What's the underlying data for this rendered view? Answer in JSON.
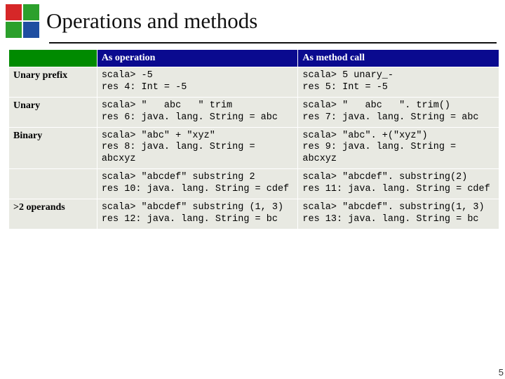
{
  "title": "Operations and methods",
  "logo_colors": {
    "tl": "#d62728",
    "tr": "#2ca02c",
    "bl": "#2ca02c",
    "br": "#1f4ea1"
  },
  "header": {
    "corner": "",
    "col1": "As operation",
    "col2": "As method call"
  },
  "rows": [
    {
      "label": "Unary prefix",
      "op": "scala> -5\nres 4: Int = -5",
      "mc": "scala> 5 unary_-\nres 5: Int = -5"
    },
    {
      "label": "Unary",
      "op": "scala> \"   abc   \" trim\nres 6: java. lang. String = abc",
      "mc": "scala> \"   abc   \". trim()\nres 7: java. lang. String = abc"
    },
    {
      "label": "Binary",
      "op": "scala> \"abc\" + \"xyz\"\nres 8: java. lang. String = abcxyz",
      "mc": "scala> \"abc\". +(\"xyz\")\nres 9: java. lang. String = abcxyz"
    },
    {
      "label": "",
      "op": "scala> \"abcdef\" substring 2\nres 10: java. lang. String = cdef",
      "mc": "scala> \"abcdef\". substring(2)\nres 11: java. lang. String = cdef"
    },
    {
      "label": ">2 operands",
      "op": "scala> \"abcdef\" substring (1, 3)\nres 12: java. lang. String = bc",
      "mc": "scala> \"abcdef\". substring(1, 3)\nres 13: java. lang. String = bc"
    }
  ],
  "page_corner": "5"
}
